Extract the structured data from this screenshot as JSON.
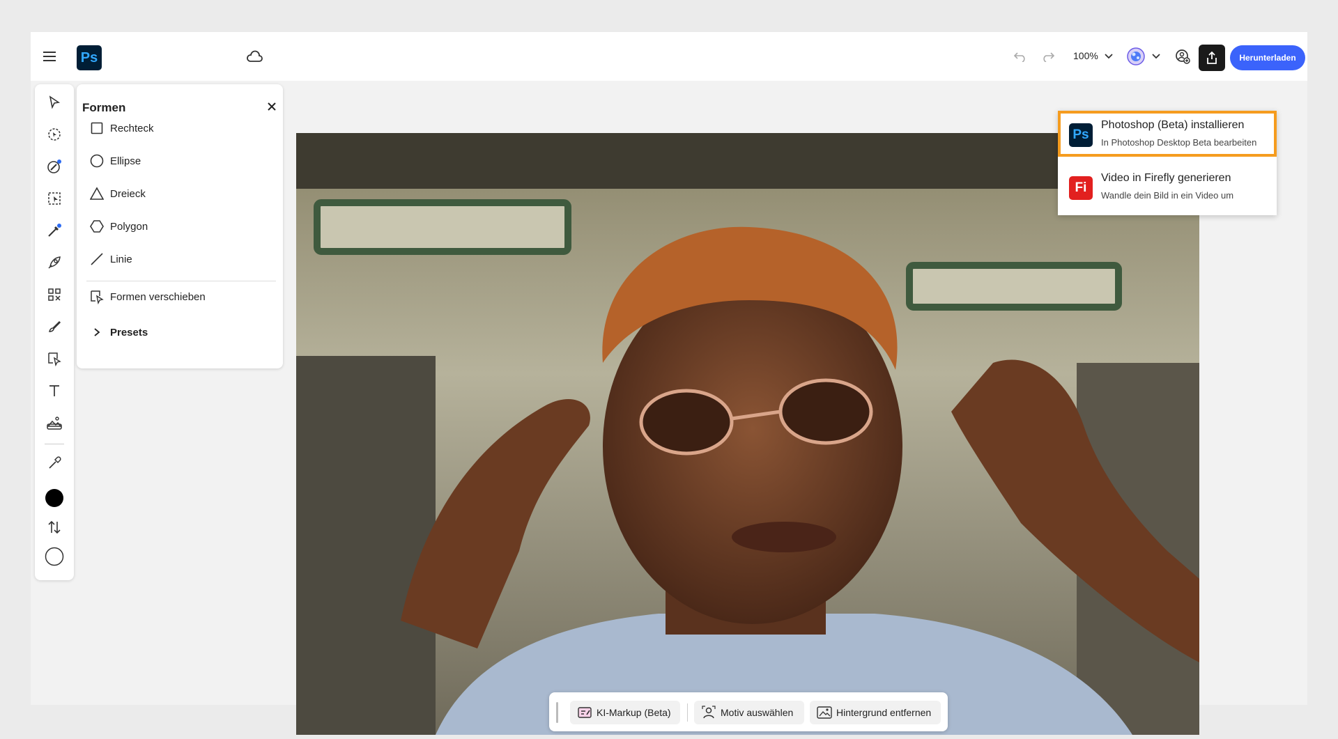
{
  "topbar": {
    "app_logo": "Ps",
    "zoom": "100%",
    "download_label": "Herunterladen"
  },
  "icons": {
    "menu": "hamburger-icon",
    "cloud": "cloud-icon",
    "undo": "undo-icon",
    "redo": "redo-icon",
    "share": "share-icon"
  },
  "shapes_panel": {
    "title": "Formen",
    "items": [
      {
        "label": "Rechteck",
        "icon": "rectangle-icon"
      },
      {
        "label": "Ellipse",
        "icon": "ellipse-icon"
      },
      {
        "label": "Dreieck",
        "icon": "triangle-icon"
      },
      {
        "label": "Polygon",
        "icon": "polygon-icon"
      },
      {
        "label": "Linie",
        "icon": "line-icon"
      }
    ],
    "move_label": "Formen verschieben",
    "presets_label": "Presets"
  },
  "context_bar": {
    "markup_label": "KI-Markup (Beta)",
    "select_subject_label": "Motiv auswählen",
    "remove_bg_label": "Hintergrund entfernen"
  },
  "menu": {
    "items": [
      {
        "badge": "Ps",
        "title": "Photoshop (Beta) installieren",
        "subtitle": "In Photoshop Desktop Beta bearbeiten",
        "badge_bg": "#001e36",
        "badge_fg": "#31a8ff"
      },
      {
        "badge": "Fi",
        "title": "Video in Firefly generieren",
        "subtitle": "Wandle dein Bild in ein Video um",
        "badge_bg": "#e2201f",
        "badge_fg": "#ffffff"
      }
    ]
  },
  "colors": {
    "accent": "#3b63fb",
    "highlight": "#f59c1f",
    "foreground_swatch": "#000000",
    "background_swatch": "#ffffff"
  }
}
